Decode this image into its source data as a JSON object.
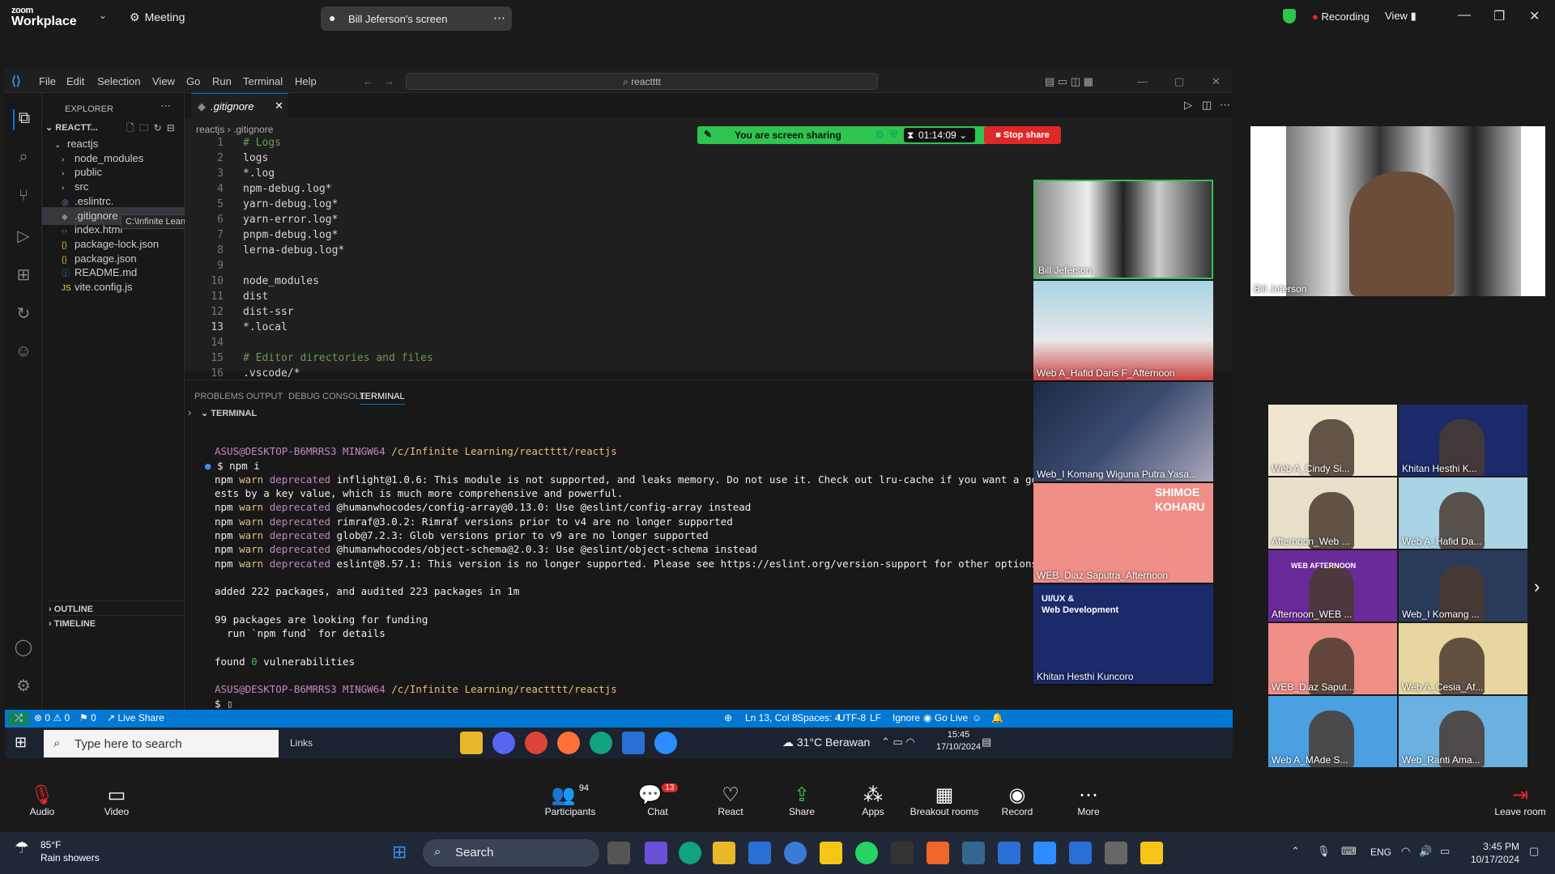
{
  "zoom": {
    "logo_line1": "zoom",
    "logo_line2": "Workplace",
    "meeting_label": "Meeting",
    "sharing_title": "Bill Jeferson's screen",
    "recording_label": "Recording",
    "view_label": "View",
    "share_banner": {
      "text": "You are screen sharing",
      "timer": "01:14:09",
      "stop_label": "Stop share"
    },
    "big_video_name": "Bill Jeferson",
    "controls": [
      {
        "label": "Audio",
        "icon": "mic-muted-icon"
      },
      {
        "label": "Video",
        "icon": "video-icon"
      },
      {
        "label": "Participants",
        "icon": "participants-icon",
        "count": "94"
      },
      {
        "label": "Chat",
        "icon": "chat-icon",
        "badge": "13"
      },
      {
        "label": "React",
        "icon": "heart-icon"
      },
      {
        "label": "Share",
        "icon": "share-icon"
      },
      {
        "label": "Apps",
        "icon": "apps-icon"
      },
      {
        "label": "Breakout rooms",
        "icon": "breakout-icon"
      },
      {
        "label": "Record",
        "icon": "record-icon"
      },
      {
        "label": "More",
        "icon": "more-icon"
      }
    ],
    "leave_label": "Leave room",
    "gallery": [
      {
        "name": "Web A_Cindy Si..."
      },
      {
        "name": "Khitan Hesthi K..."
      },
      {
        "name": "Afternoon_Web ..."
      },
      {
        "name": "Web A_Hafid Da..."
      },
      {
        "name": "Afternoon_WEB ..."
      },
      {
        "name": "Web_I Komang ..."
      },
      {
        "name": "WEB_Diaz Saput..."
      },
      {
        "name": "Web A_Cesia_Af..."
      },
      {
        "name": "Web A_MAde S..."
      },
      {
        "name": "Web_Ranti Ama..."
      }
    ],
    "shared_strip": [
      {
        "name": "Bill Jeferson"
      },
      {
        "name": "Web A_Hafid Daris F_Afternoon"
      },
      {
        "name": "Web_I Komang Wiguna Putra Yasa..."
      },
      {
        "name": "WEB_Diaz Saputra_Afternoon"
      },
      {
        "name": "Khitan Hesthi Kuncoro"
      }
    ],
    "strip_overlay_texts": [
      "SHIMOE",
      "KOHARU",
      "UI/UX &",
      "Web Development",
      "WEB AFTERNOON"
    ]
  },
  "vscode": {
    "menus": [
      "File",
      "Edit",
      "Selection",
      "View",
      "Go",
      "Run",
      "Terminal",
      "Help"
    ],
    "search_text": "reactttt",
    "explorer_title": "EXPLORER",
    "workspace": "REACTT...",
    "tree": [
      {
        "label": "reactjs",
        "indent": 1,
        "kind": "folder-open"
      },
      {
        "label": "node_modules",
        "indent": 2,
        "kind": "folder"
      },
      {
        "label": "public",
        "indent": 2,
        "kind": "folder"
      },
      {
        "label": "src",
        "indent": 2,
        "kind": "folder"
      },
      {
        "label": ".eslintrc.",
        "indent": 2,
        "kind": "file-eslint"
      },
      {
        "label": ".gitignore",
        "indent": 2,
        "kind": "file-git"
      },
      {
        "label": "index.html",
        "indent": 2,
        "kind": "file-html"
      },
      {
        "label": "package-lock.json",
        "indent": 2,
        "kind": "file-json"
      },
      {
        "label": "package.json",
        "indent": 2,
        "kind": "file-json"
      },
      {
        "label": "README.md",
        "indent": 2,
        "kind": "file-md"
      },
      {
        "label": "vite.config.js",
        "indent": 2,
        "kind": "file-js"
      }
    ],
    "tooltip": "C:\\Infinite Learning\\reactttt\\reactjs\\src",
    "outline_label": "OUTLINE",
    "timeline_label": "TIMELINE",
    "tab_label": ".gitignore",
    "breadcrumb": [
      "reactjs",
      ".gitignore"
    ],
    "code_lines": [
      {
        "n": "1",
        "t": "# Logs",
        "k": "cmt"
      },
      {
        "n": "2",
        "t": "logs",
        "k": "txt"
      },
      {
        "n": "3",
        "t": "*.log",
        "k": "txt"
      },
      {
        "n": "4",
        "t": "npm-debug.log*",
        "k": "txt"
      },
      {
        "n": "5",
        "t": "yarn-debug.log*",
        "k": "txt"
      },
      {
        "n": "6",
        "t": "yarn-error.log*",
        "k": "txt"
      },
      {
        "n": "7",
        "t": "pnpm-debug.log*",
        "k": "txt"
      },
      {
        "n": "8",
        "t": "lerna-debug.log*",
        "k": "txt"
      },
      {
        "n": "9",
        "t": "",
        "k": "txt"
      },
      {
        "n": "10",
        "t": "node_modules",
        "k": "txt"
      },
      {
        "n": "11",
        "t": "dist",
        "k": "txt"
      },
      {
        "n": "12",
        "t": "dist-ssr",
        "k": "txt"
      },
      {
        "n": "13",
        "t": "*.local",
        "k": "txt"
      },
      {
        "n": "14",
        "t": "",
        "k": "txt"
      },
      {
        "n": "15",
        "t": "# Editor directories and files",
        "k": "cmt"
      },
      {
        "n": "16",
        "t": ".vscode/*",
        "k": "txt"
      }
    ],
    "panel_tabs": [
      "PROBLEMS",
      "OUTPUT",
      "DEBUG CONSOLE",
      "TERMINAL"
    ],
    "terminal_header": "TERMINAL",
    "prompt": {
      "user": "ASUS@DESKTOP-B6MRRS3",
      "shell": "MINGW64",
      "path": "/c/Infinite Learning/reactttt/reactjs"
    },
    "command": "$ npm i",
    "warnings": [
      {
        "pkg": "inflight@1.0.6:",
        "msg": "This module is not supported, and leaks memory. Do not use it. Check out lru-cache if you want a good and"
      },
      {
        "pkg": "",
        "msg": "ests by a key value, which is much more comprehensive and powerful."
      },
      {
        "pkg": "@humanwhocodes/config-array@0.13.0:",
        "msg": "Use @eslint/config-array instead"
      },
      {
        "pkg": "rimraf@3.0.2:",
        "msg": "Rimraf versions prior to v4 are no longer supported"
      },
      {
        "pkg": "glob@7.2.3:",
        "msg": "Glob versions prior to v9 are no longer supported"
      },
      {
        "pkg": "@humanwhocodes/object-schema@2.0.3:",
        "msg": "Use @eslint/object-schema instead"
      },
      {
        "pkg": "eslint@8.57.1:",
        "msg": "This version is no longer supported. Please see https://eslint.org/version-support for other options."
      }
    ],
    "npm": "npm",
    "warn": "warn",
    "deprecated": "deprecated",
    "added": "added 222 packages, and audited 223 packages in 1m",
    "funding1": "99 packages are looking for funding",
    "funding2": "  run `npm fund` for details",
    "found_pre": "found ",
    "found_num": "0",
    "found_post": " vulnerabilities",
    "prompt2_dollar": "$",
    "status": {
      "errors": "0",
      "warnings": "0",
      "ports": "0",
      "live_share": "Live Share",
      "position": "Ln 13, Col 8",
      "spaces": "Spaces: 4",
      "encoding": "UTF-8",
      "eol": "LF",
      "lang": "Ignore",
      "go_live": "Go Live"
    },
    "taskbar": {
      "search": "Type here to search",
      "links": "Links",
      "weather": "31°C  Berawan",
      "time": "15:45",
      "date": "17/10/2024"
    }
  },
  "windows": {
    "weather_temp": "85°F",
    "weather_desc": "Rain showers",
    "search": "Search",
    "lang": "ENG",
    "time": "3:45 PM",
    "date": "10/17/2024"
  }
}
